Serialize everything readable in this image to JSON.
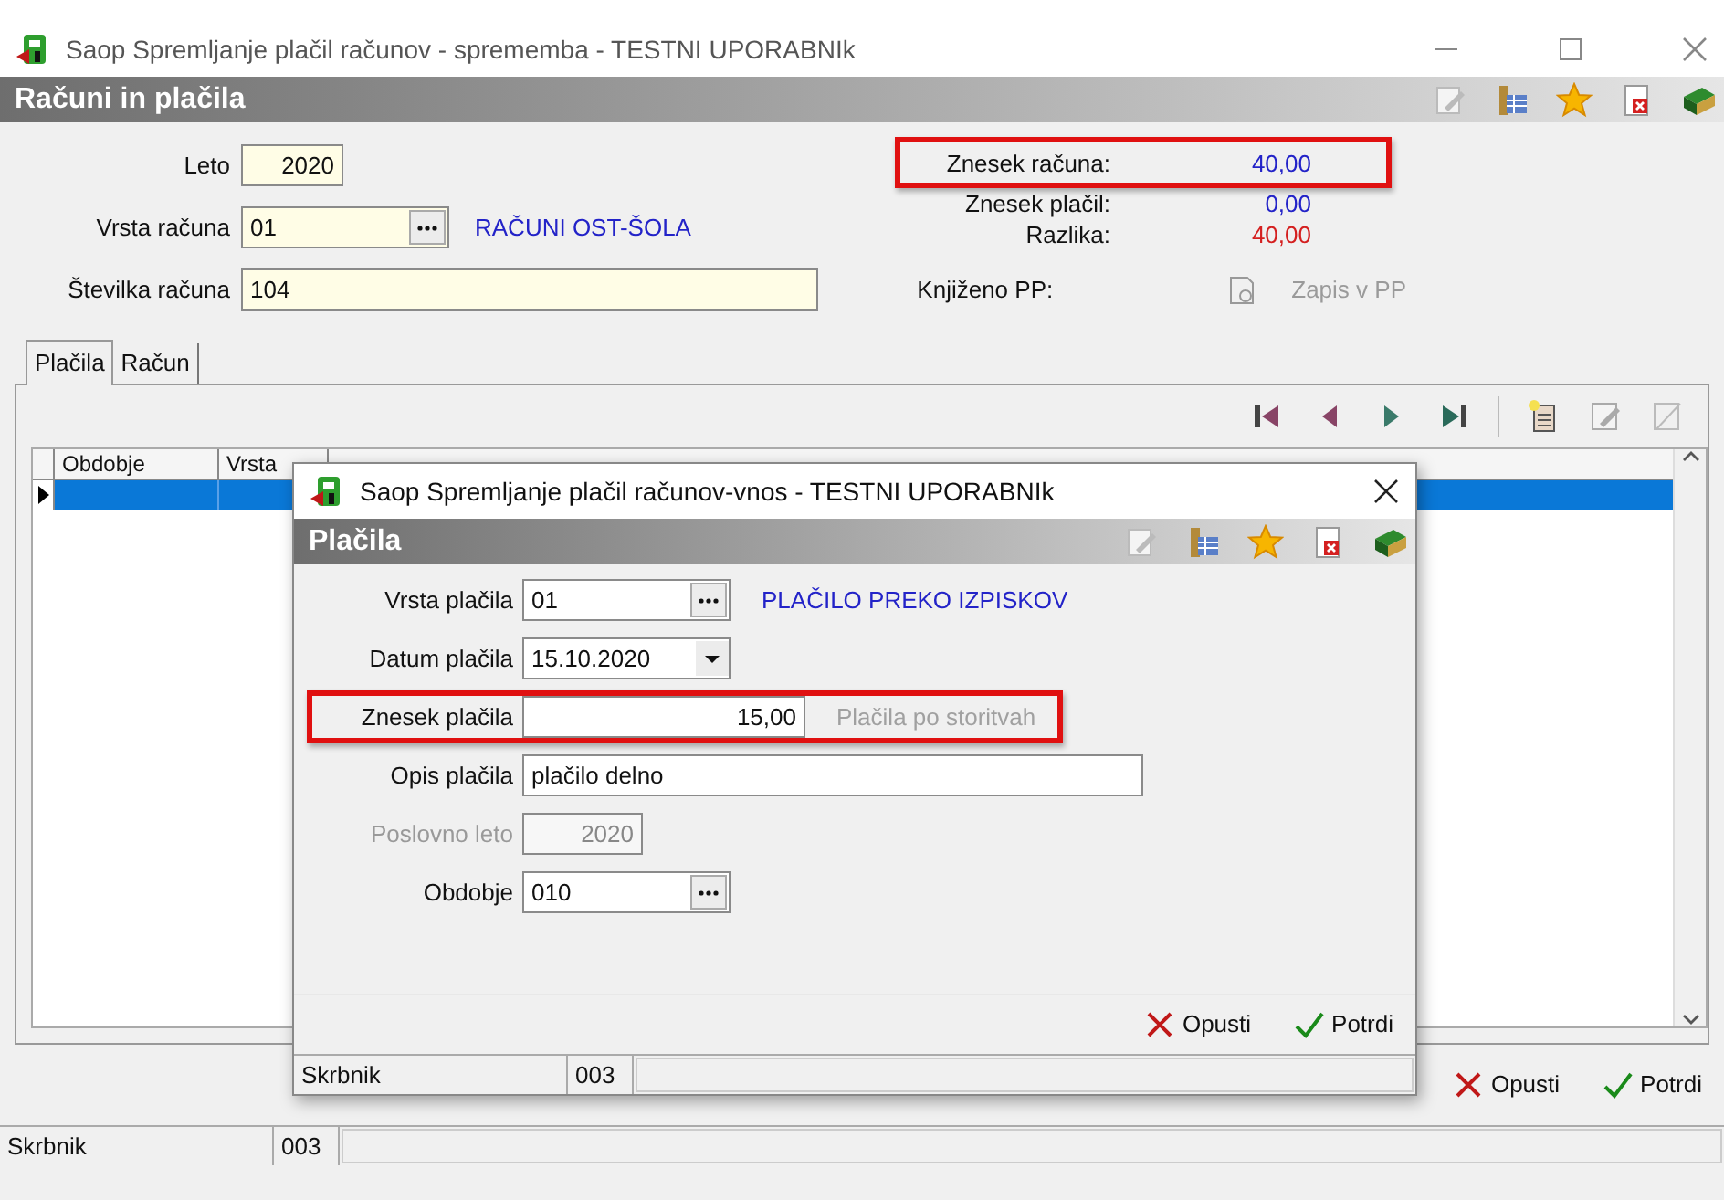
{
  "window": {
    "title": "Saop Spremljanje plačil računov - sprememba - TESTNI UPORABNIk"
  },
  "header": {
    "title": "Računi in plačila"
  },
  "form": {
    "fields": [
      {
        "label": "Leto",
        "value": "2020",
        "kind": "year"
      },
      {
        "label": "Vrsta računa",
        "value": "01",
        "kind": "lookup",
        "link": "RAČUNI OST-ŠOLA"
      },
      {
        "label": "Številka računa",
        "value": "104",
        "kind": "text"
      }
    ]
  },
  "totals": [
    {
      "label": "Znesek računa:",
      "value": "40,00",
      "color": "#2323c8",
      "highlighted": true
    },
    {
      "label": "Znesek plačil:",
      "value": "0,00",
      "color": "#2323c8",
      "highlighted": false
    },
    {
      "label": "Razlika:",
      "value": "40,00",
      "color": "#d42020",
      "highlighted": false
    }
  ],
  "posting": {
    "label": "Knjiženo PP:",
    "button": "Zapis v PP",
    "disabled": true
  },
  "tabs": [
    {
      "label": "Plačila",
      "selected": true
    },
    {
      "label": "Račun",
      "selected": false
    }
  ],
  "grid": {
    "columns": [
      "Obdobje",
      "Vrsta"
    ],
    "rows": [
      {
        "selected": true
      }
    ]
  },
  "buttons": [
    {
      "label": "Opusti",
      "kind": "cancel"
    },
    {
      "label": "Potrdi",
      "kind": "confirm"
    }
  ],
  "status_bar": [
    "Skrbnik",
    "003"
  ],
  "dialog": {
    "title": "Saop Spremljanje plačil računov-vnos - TESTNI UPORABNIk",
    "header": "Plačila",
    "fields": [
      {
        "label": "Vrsta plačila",
        "value": "01",
        "kind": "lookup",
        "link": "PLAČILO PREKO IZPISKOV",
        "disabled": false,
        "highlighted": false
      },
      {
        "label": "Datum plačila",
        "value": "15.10.2020",
        "kind": "date",
        "disabled": false,
        "highlighted": false
      },
      {
        "label": "Znesek plačila",
        "value": "15,00",
        "kind": "amount",
        "button": "Plačila po storitvah",
        "disabled": false,
        "highlighted": true
      },
      {
        "label": "Opis plačila",
        "value": "plačilo delno",
        "kind": "text",
        "disabled": false,
        "highlighted": false
      },
      {
        "label": "Poslovno leto",
        "value": "2020",
        "kind": "year",
        "disabled": true,
        "highlighted": false
      },
      {
        "label": "Obdobje",
        "value": "010",
        "kind": "lookup",
        "disabled": false,
        "highlighted": false
      }
    ],
    "buttons": [
      {
        "label": "Opusti",
        "kind": "cancel"
      },
      {
        "label": "Potrdi",
        "kind": "confirm"
      }
    ],
    "status_bar": [
      "Skrbnik",
      "003"
    ]
  }
}
